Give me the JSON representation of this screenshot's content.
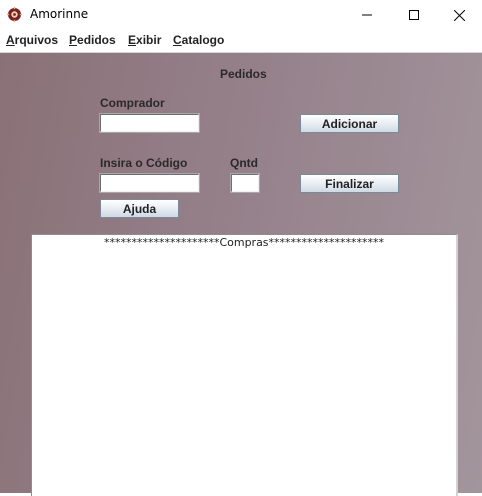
{
  "window": {
    "title": "Amorinne",
    "icon": "amorinne-app-icon"
  },
  "menu": [
    {
      "mnemonic": "A",
      "rest": "rquivos"
    },
    {
      "mnemonic": "P",
      "rest": "edidos"
    },
    {
      "mnemonic": "E",
      "rest": "xibir"
    },
    {
      "mnemonic": "C",
      "rest": "atalogo"
    }
  ],
  "form": {
    "header": "Pedidos",
    "buyer_label": "Comprador",
    "buyer_value": "",
    "add_button": "Adicionar",
    "code_label": "Insira o Código",
    "code_value": "",
    "qty_label": "Qntd",
    "qty_value": "",
    "finish_button": "Finalizar",
    "help_button": "Ajuda"
  },
  "purchases": {
    "text": "*********************Compras*********************"
  },
  "colors": {
    "panel_start": "#8a7177",
    "panel_end": "#a3959c",
    "icon_primary": "#7a1f2b"
  }
}
